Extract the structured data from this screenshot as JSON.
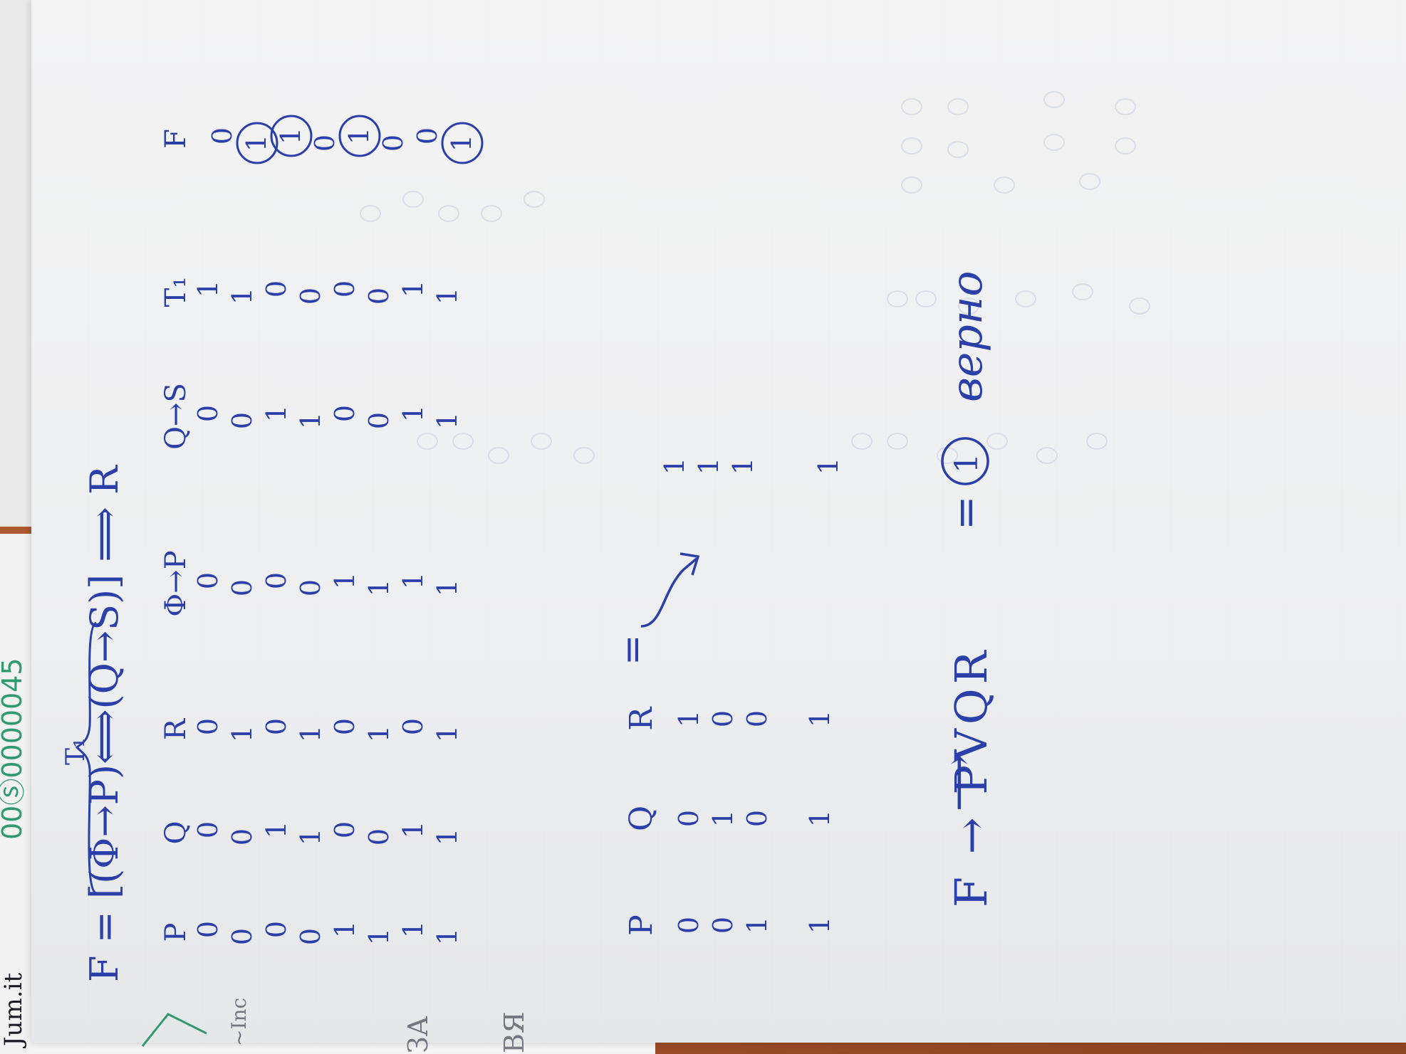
{
  "note": {
    "formula": "F = [(Φ→P)⟺(Q→S)] ⟹ R",
    "subformula_label": "T₁",
    "table": {
      "headers": [
        "P",
        "Q",
        "R",
        "Φ→P",
        "Q→S",
        "T₁",
        "F"
      ],
      "rows": [
        [
          "0",
          "0",
          "0",
          "0",
          "0",
          "1",
          "0"
        ],
        [
          "0",
          "0",
          "1",
          "0",
          "0",
          "1",
          "1"
        ],
        [
          "0",
          "1",
          "0",
          "0",
          "1",
          "0",
          "1"
        ],
        [
          "0",
          "1",
          "1",
          "0",
          "1",
          "0",
          "0"
        ],
        [
          "1",
          "0",
          "0",
          "1",
          "0",
          "0",
          "1"
        ],
        [
          "1",
          "0",
          "1",
          "1",
          "0",
          "0",
          "0"
        ],
        [
          "1",
          "1",
          "0",
          "1",
          "1",
          "1",
          "0"
        ],
        [
          "1",
          "1",
          "1",
          "1",
          "1",
          "1",
          "1"
        ]
      ],
      "circled_in_last_column": [
        1,
        2,
        4,
        7
      ]
    },
    "second_table": {
      "headers": [
        "P",
        "Q",
        "R"
      ],
      "rows": [
        [
          "0",
          "0",
          "1"
        ],
        [
          "0",
          "1",
          "0"
        ],
        [
          "1",
          "0",
          "0"
        ],
        [
          "1",
          "1",
          "1"
        ]
      ],
      "result_column": [
        "1",
        "1",
        "1",
        "1"
      ],
      "arrow_label": "=",
      "result_sign": "⟶"
    },
    "conclusion": {
      "lhs": "F → PVQR",
      "equals": "=",
      "value": "1",
      "word": "верно"
    }
  },
  "background_notes": {
    "green_digits": "00Ⓢ0000045",
    "black_text": "Jum.it",
    "corner_marks": [
      "~Inc",
      "ЗА",
      "ВЯ"
    ]
  },
  "colors": {
    "ink": "#2a3fa8",
    "paper": "#efeff0",
    "desk": "#a9562f",
    "green_pen": "#2f9a6d"
  }
}
